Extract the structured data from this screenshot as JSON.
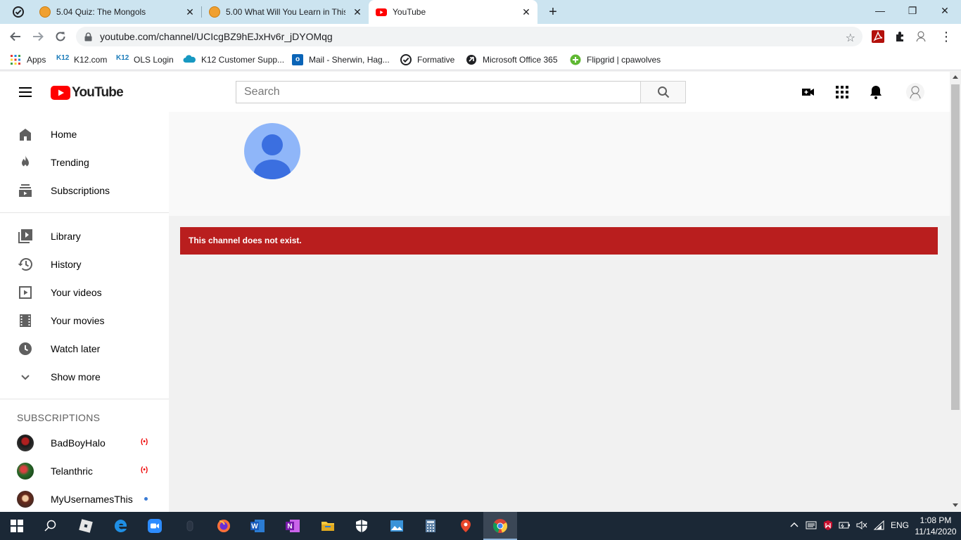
{
  "browser": {
    "tabs": [
      {
        "title": "5.04 Quiz: The Mongols",
        "favicon": "k12-coin-icon",
        "close": "✕"
      },
      {
        "title": "5.00 What Will You Learn in This Unit",
        "favicon": "k12-coin-icon",
        "close": "✕"
      },
      {
        "title": "YouTube",
        "favicon": "youtube-icon",
        "close": "✕"
      }
    ],
    "new_tab": "+",
    "window": {
      "minimize": "—",
      "restore": "❐",
      "close": "✕"
    },
    "url": "youtube.com/channel/UCIcgBZ9hEJxHv6r_jDYOMqg",
    "star": "☆",
    "more": "⋮",
    "bookmarks": [
      {
        "label": "Apps",
        "icon": "apps-grid-icon"
      },
      {
        "label": "K12.com",
        "icon": "k12-icon",
        "badge": "K12"
      },
      {
        "label": "OLS Login",
        "icon": "k12-icon",
        "badge": "K12"
      },
      {
        "label": "K12 Customer Supp...",
        "icon": "salesforce-cloud-icon"
      },
      {
        "label": "Mail - Sherwin, Hag...",
        "icon": "outlook-icon"
      },
      {
        "label": "Formative",
        "icon": "formative-icon"
      },
      {
        "label": "Microsoft Office 365",
        "icon": "office-icon"
      },
      {
        "label": "Flipgrid | cpawolves",
        "icon": "flipgrid-icon"
      }
    ]
  },
  "youtube": {
    "logo_text": "YouTube",
    "search_placeholder": "Search",
    "sidebar": {
      "primary": [
        {
          "label": "Home",
          "icon": "home-icon"
        },
        {
          "label": "Trending",
          "icon": "fire-icon"
        },
        {
          "label": "Subscriptions",
          "icon": "subscriptions-icon"
        }
      ],
      "secondary": [
        {
          "label": "Library",
          "icon": "library-icon"
        },
        {
          "label": "History",
          "icon": "history-icon"
        },
        {
          "label": "Your videos",
          "icon": "your-videos-icon"
        },
        {
          "label": "Your movies",
          "icon": "film-icon"
        },
        {
          "label": "Watch later",
          "icon": "clock-icon"
        },
        {
          "label": "Show more",
          "icon": "chevron-down-icon"
        }
      ],
      "subscriptions_title": "SUBSCRIPTIONS",
      "subscriptions": [
        {
          "name": "BadBoyHalo",
          "status": "live",
          "live_glyph": "(•)"
        },
        {
          "name": "Telanthric",
          "status": "live",
          "live_glyph": "(•)"
        },
        {
          "name": "MyUsernamesThis",
          "status": "new"
        }
      ]
    },
    "error_message": "This channel does not exist.",
    "colors": {
      "brand_red": "#ff0000",
      "error_red": "#b91e1e",
      "avatar_blue": "#8fb6f9"
    }
  },
  "taskbar": {
    "language": "ENG",
    "time": "1:08 PM",
    "date": "11/14/2020"
  }
}
